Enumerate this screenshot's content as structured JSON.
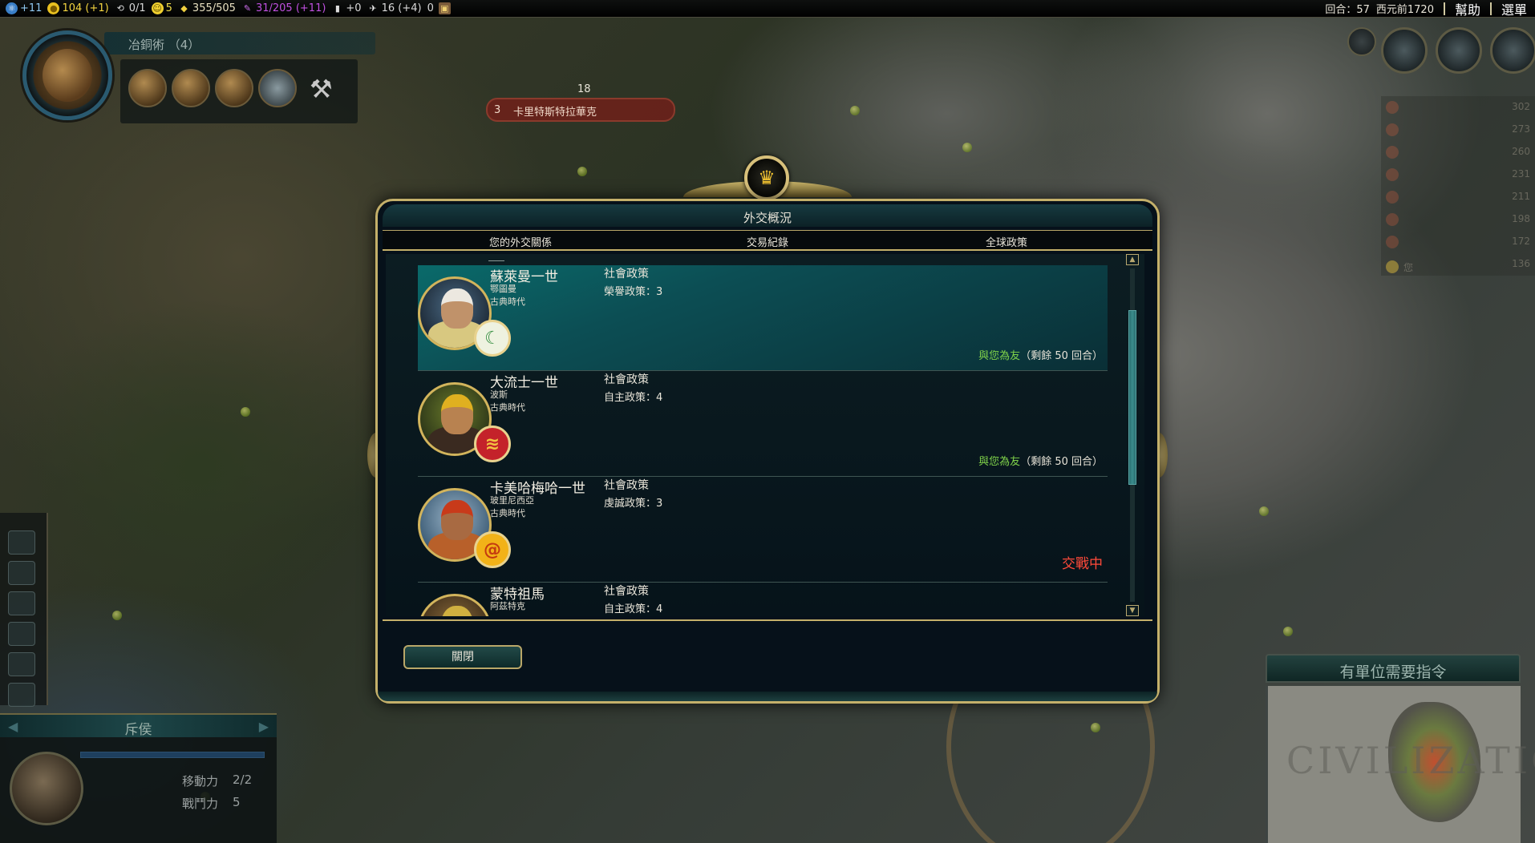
{
  "topbar": {
    "science": "+11",
    "gold": "104",
    "gold_rate": "(+1)",
    "trade_routes": "0/1",
    "happiness": "5",
    "golden_age": "355/505",
    "culture": "31/205",
    "culture_rate": "(+11)",
    "tourism": "+0",
    "faith": "16",
    "faith_rate": "(+4)",
    "great_works": "0",
    "turn": "回合：57",
    "year": "西元前1720",
    "help": "幫助",
    "menu": "選單"
  },
  "tech": {
    "name": "冶銅術 （4）"
  },
  "city_banner": {
    "size": "3",
    "name": "卡里特斯特拉華克",
    "strength": "18"
  },
  "dialog": {
    "title": "外交概況",
    "tabs": [
      "您的外交關係",
      "交易紀錄",
      "全球政策"
    ],
    "close_label": "關閉",
    "rows": [
      {
        "leader": "蘇萊曼一世",
        "civ": "鄂圖曼",
        "era": "古典時代",
        "policy_header": "社會政策",
        "policy_value": "榮譽政策：3",
        "status_friend": "與您為友",
        "status_rest": "（剩餘 50 回合）",
        "status_war": "",
        "emblem": "☾",
        "emblem_bg": "#eef2e0",
        "emblem_color": "#2e8a3a"
      },
      {
        "leader": "大流士一世",
        "civ": "波斯",
        "era": "古典時代",
        "policy_header": "社會政策",
        "policy_value": "自主政策：4",
        "status_friend": "與您為友",
        "status_rest": "（剩餘 50 回合）",
        "status_war": "",
        "emblem": "≋",
        "emblem_bg": "#c4222a",
        "emblem_color": "#f2c440"
      },
      {
        "leader": "卡美哈梅哈一世",
        "civ": "玻里尼西亞",
        "era": "古典時代",
        "policy_header": "社會政策",
        "policy_value": "虔誠政策：3",
        "status_friend": "",
        "status_rest": "",
        "status_war": "交戰中",
        "emblem": "@",
        "emblem_bg": "#f2b218",
        "emblem_color": "#c43a10"
      },
      {
        "leader": "蒙特祖馬",
        "civ": "阿茲特克",
        "era": "",
        "policy_header": "社會政策",
        "policy_value": "自主政策：4",
        "status_friend": "",
        "status_rest": "",
        "status_war": "",
        "emblem": "",
        "emblem_bg": "#e0c060",
        "emblem_color": "#2a6a3a"
      }
    ]
  },
  "unit": {
    "name": "斥侯",
    "moves_label": "移動力",
    "moves_value": "2/2",
    "strength_label": "戰鬥力",
    "strength_value": "5"
  },
  "minimap": {
    "title": "有單位需要指令"
  },
  "scoreboard": {
    "values": [
      "302",
      "273",
      "260",
      "231",
      "211",
      "198",
      "172",
      "136"
    ],
    "you_label": "您"
  }
}
